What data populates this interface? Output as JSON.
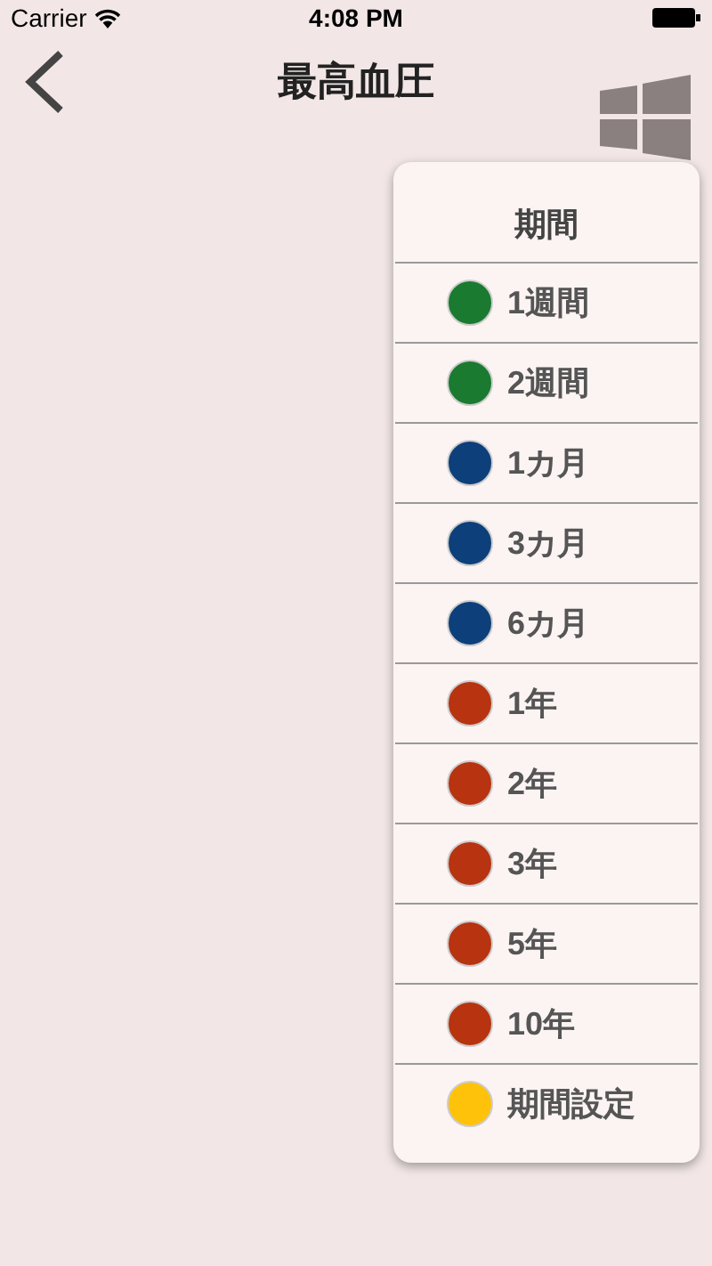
{
  "status_bar": {
    "carrier": "Carrier",
    "time": "4:08 PM"
  },
  "nav": {
    "title": "最高血圧"
  },
  "menu": {
    "title": "期間",
    "items": [
      {
        "label": "1週間",
        "color": "#1a7a30"
      },
      {
        "label": "2週間",
        "color": "#1a7a30"
      },
      {
        "label": "1カ月",
        "color": "#0d3f7a"
      },
      {
        "label": "3カ月",
        "color": "#0d3f7a"
      },
      {
        "label": "6カ月",
        "color": "#0d3f7a"
      },
      {
        "label": "1年",
        "color": "#b8330f"
      },
      {
        "label": "2年",
        "color": "#b8330f"
      },
      {
        "label": "3年",
        "color": "#b8330f"
      },
      {
        "label": "5年",
        "color": "#b8330f"
      },
      {
        "label": "10年",
        "color": "#b8330f"
      },
      {
        "label": "期間設定",
        "color": "#ffc20a"
      }
    ]
  }
}
